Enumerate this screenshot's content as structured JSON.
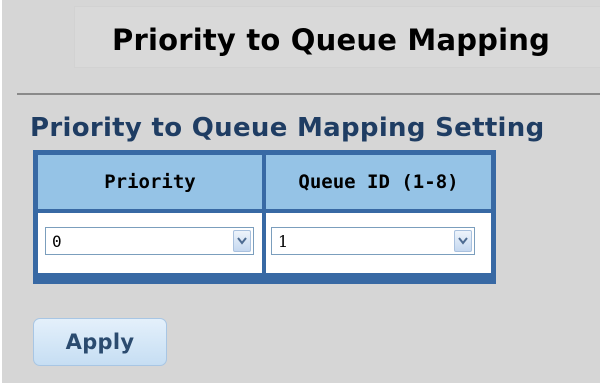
{
  "page": {
    "title": "Priority to Queue Mapping",
    "section_title": "Priority to Queue Mapping Setting"
  },
  "table": {
    "headers": [
      "Priority",
      "Queue ID (1-8)"
    ],
    "row": {
      "priority_value": "0",
      "queue_id_value": "1"
    }
  },
  "actions": {
    "apply_label": "Apply"
  },
  "icons": {
    "dropdown": "chevron-down-icon"
  },
  "colors": {
    "table_border": "#3869a4",
    "header_background": "#95c3e6",
    "section_title": "#1f3d63",
    "button_background": "#d6e7f7"
  }
}
